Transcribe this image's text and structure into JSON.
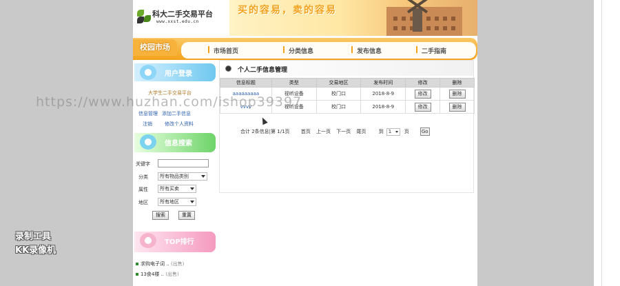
{
  "header": {
    "site_title": "科大二手交易平台",
    "site_url": "www.xxst.edu.cn",
    "slogan": "买的容易，卖的容易"
  },
  "nav": {
    "section_tab": "校园市场",
    "items": [
      {
        "label": "市场首页"
      },
      {
        "label": "分类信息"
      },
      {
        "label": "发布信息"
      },
      {
        "label": "二手指南"
      }
    ]
  },
  "sidebar": {
    "login": {
      "title": "用户登录",
      "welcome": "大学生二手交易平台",
      "links": [
        "信息管理",
        "添加二手信息",
        "注销",
        "修改个人资料"
      ]
    },
    "search": {
      "title": "信息搜索",
      "keyword_label": "关键字",
      "keyword_value": "",
      "category_label": "分类",
      "category_value": "所有物品类别",
      "attribute_label": "属性",
      "attribute_value": "所有买卖",
      "area_label": "地区",
      "area_value": "所有地区",
      "search_button": "搜索",
      "reset_button": "重置"
    },
    "top": {
      "title": "TOP排行",
      "items": [
        {
          "text": "求购电子词 ..",
          "tag": "(出售)"
        },
        {
          "text": "13食4楼 ..",
          "tag": "(出售)"
        }
      ]
    }
  },
  "main": {
    "title": "个人二手信息管理",
    "columns": [
      "信息标题",
      "类型",
      "交易地区",
      "发布时间",
      "修改",
      "删除"
    ],
    "rows": [
      {
        "title": "aaaaaaaaa",
        "type": "视听设备",
        "area": "校门口",
        "date": "2018-8-9",
        "edit": "修改",
        "delete": "删除"
      },
      {
        "title": "vvvv",
        "type": "视听设备",
        "area": "校门口",
        "date": "2018-8-9",
        "edit": "修改",
        "delete": "删除"
      }
    ],
    "pager": {
      "summary": "合计 2条信息|第 1/1页",
      "first": "首页",
      "prev": "上一页",
      "next": "下一页",
      "last": "尾页",
      "goto_label": "到",
      "page_value": "1",
      "page_unit": "页",
      "go_button": "Go"
    }
  },
  "overlay": {
    "watermark": "https://www.huzhan.com/ishop39397",
    "rec_line1": "录制工具",
    "rec_line2": "KK录像机"
  }
}
